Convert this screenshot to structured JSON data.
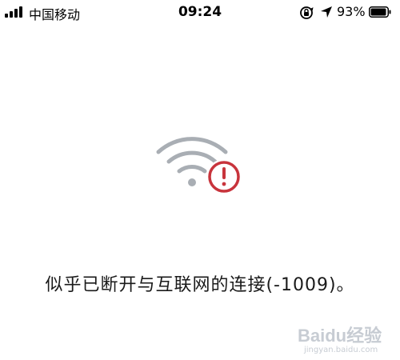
{
  "status_bar": {
    "carrier": "中国移动",
    "time": "09:24",
    "battery_percent": "93%",
    "signal_bars": 4,
    "icons": [
      "signal-icon",
      "rotation-lock-icon",
      "location-arrow-icon",
      "battery-icon"
    ]
  },
  "main": {
    "error_message": "似乎已断开与互联网的连接(-1009)。",
    "icon": "wifi-error-icon",
    "colors": {
      "wifi_gray": "#a9aeb4",
      "error_red": "#c8343c"
    }
  },
  "watermark": {
    "logo": "Baidu经验",
    "url": "jingyan.baidu.com"
  }
}
